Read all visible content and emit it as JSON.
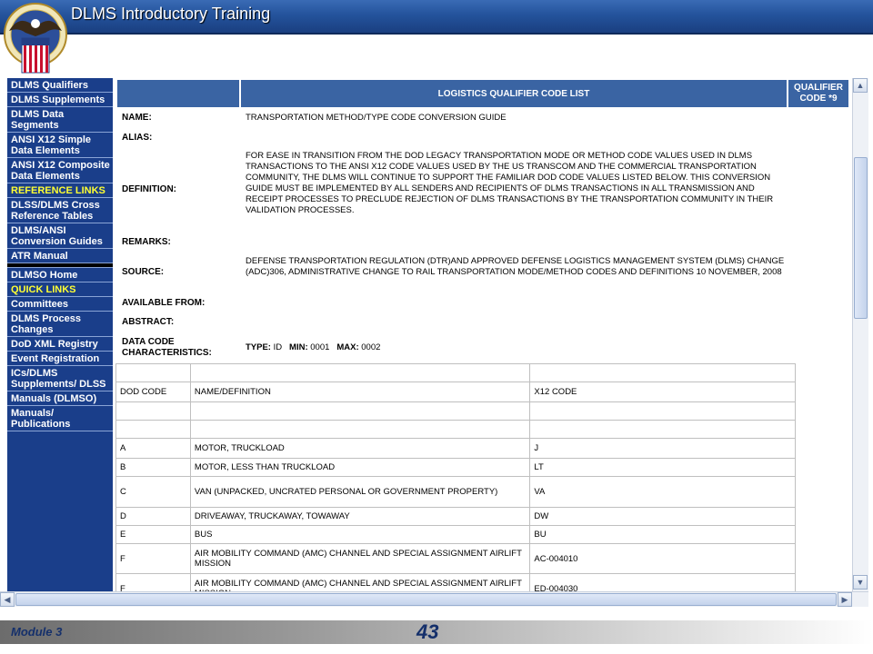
{
  "header": {
    "title": "DLMS Introductory Training"
  },
  "sidebar": {
    "items": [
      {
        "label": "DLMS Qualifiers",
        "heading": false
      },
      {
        "label": "DLMS Supplements",
        "heading": false
      },
      {
        "label": "DLMS Data Segments",
        "heading": false
      },
      {
        "label": "ANSI X12 Simple Data Elements",
        "heading": false
      },
      {
        "label": "ANSI X12 Composite Data Elements",
        "heading": false
      },
      {
        "label": "REFERENCE LINKS",
        "heading": true
      },
      {
        "label": "DLSS/DLMS Cross Reference Tables",
        "heading": false
      },
      {
        "label": "DLMS/ANSI Conversion Guides",
        "heading": false
      },
      {
        "label": "ATR Manual",
        "heading": false
      },
      {
        "label": "",
        "separator": true
      },
      {
        "label": "DLMSO Home",
        "heading": false
      },
      {
        "label": "QUICK LINKS",
        "heading": true
      },
      {
        "label": "Committees",
        "heading": false
      },
      {
        "label": "DLMS Process Changes",
        "heading": false
      },
      {
        "label": "DoD XML Registry",
        "heading": false
      },
      {
        "label": "Event Registration",
        "heading": false
      },
      {
        "label": "ICs/DLMS Supplements/ DLSS",
        "heading": false
      },
      {
        "label": "Manuals (DLMSO)",
        "heading": false
      },
      {
        "label": "Manuals/ Publications",
        "heading": false
      }
    ]
  },
  "content": {
    "list_title": "LOGISTICS QUALIFIER CODE LIST",
    "qualifier_code": "QUALIFIER CODE *9",
    "fields": {
      "name_label": "NAME:",
      "name_value": "TRANSPORTATION METHOD/TYPE CODE CONVERSION GUIDE",
      "alias_label": "ALIAS:",
      "definition_label": "DEFINITION:",
      "definition_value": "FOR EASE IN TRANSITION FROM THE DOD LEGACY TRANSPORTATION MODE OR METHOD CODE VALUES USED IN DLMS TRANSACTIONS TO THE ANSI X12 CODE VALUES USED BY THE US TRANSCOM AND THE COMMERCIAL TRANSPORTATION COMMUNITY, THE DLMS WILL CONTINUE TO SUPPORT THE FAMILIAR DOD CODE VALUES LISTED BELOW. THIS CONVERSION GUIDE MUST BE IMPLEMENTED BY ALL SENDERS AND RECIPIENTS OF DLMS TRANSACTIONS IN ALL TRANSMISSION AND RECEIPT PROCESSES TO PRECLUDE REJECTION OF DLMS TRANSACTIONS BY THE TRANSPORTATION COMMUNITY IN THEIR VALIDATION PROCESSES.",
      "remarks_label": "REMARKS:",
      "source_label": "SOURCE:",
      "source_value": "DEFENSE TRANSPORTATION REGULATION (DTR)AND APPROVED DEFENSE LOGISTICS MANAGEMENT SYSTEM (DLMS) CHANGE (ADC)306, ADMINISTRATIVE CHANGE TO RAIL TRANSPORTATION MODE/METHOD CODES AND DEFINITIONS 10 NOVEMBER, 2008",
      "available_label": "AVAILABLE FROM:",
      "abstract_label": "ABSTRACT:",
      "characteristics_label": "DATA CODE CHARACTERISTICS:",
      "type_label": "TYPE:",
      "type_value": "ID",
      "min_label": "MIN:",
      "min_value": "0001",
      "max_label": "MAX:",
      "max_value": "0002"
    },
    "table": {
      "columns": [
        "DOD CODE",
        "NAME/DEFINITION",
        "X12 CODE"
      ],
      "rows": [
        [
          "A",
          "MOTOR, TRUCKLOAD",
          "J"
        ],
        [
          "B",
          "MOTOR, LESS THAN TRUCKLOAD",
          "LT"
        ],
        [
          "C",
          "VAN (UNPACKED, UNCRATED PERSONAL OR GOVERNMENT PROPERTY)",
          "VA"
        ],
        [
          "D",
          "DRIVEAWAY, TRUCKAWAY, TOWAWAY",
          "DW"
        ],
        [
          "E",
          "BUS",
          "BU"
        ],
        [
          "F",
          "AIR MOBILITY COMMAND (AMC) CHANNEL AND SPECIAL ASSIGNMENT AIRLIFT MISSION",
          "AC-004010"
        ],
        [
          "F",
          "AIR MOBILITY COMMAND (AMC) CHANNEL AND SPECIAL ASSIGNMENT AIRLIFT MISSION",
          "ED-004030"
        ]
      ]
    }
  },
  "footer": {
    "module": "Module 3",
    "page": "43"
  },
  "colors": {
    "header": "#24539c",
    "sidebar": "#1a3e8a",
    "accent_yellow": "#ffff33",
    "footer_text": "#15306b"
  }
}
